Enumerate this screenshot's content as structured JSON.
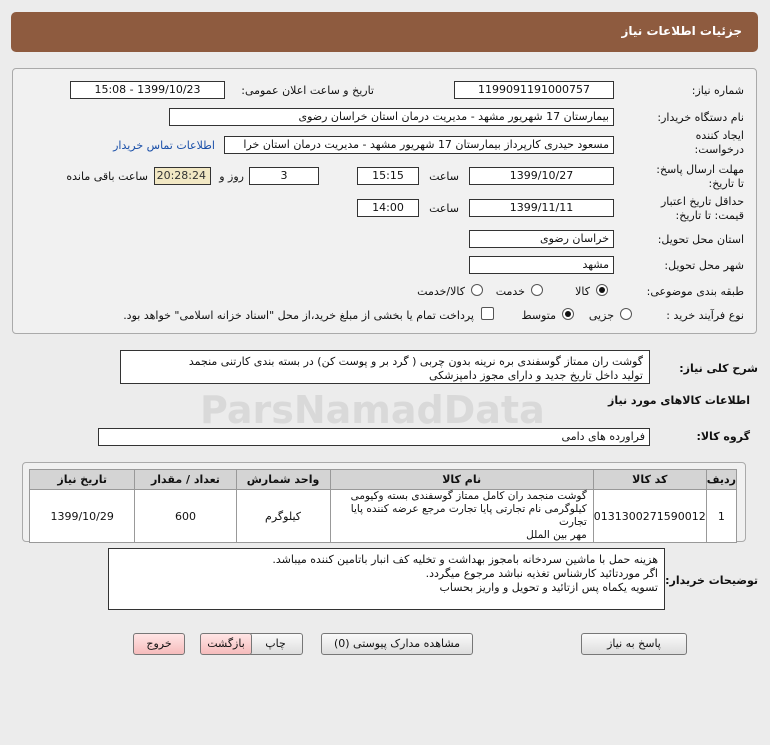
{
  "header": {
    "title": "جزئیات اطلاعات نیاز"
  },
  "form": {
    "need_number_label": "شماره نیاز:",
    "need_number": "1199091191000757",
    "announce_label": "تاریخ و ساعت اعلان عمومی:",
    "announce_value": "1399/10/23 - 15:08",
    "buyer_org_label": "نام دستگاه خریدار:",
    "buyer_org": "بیمارستان 17 شهریور مشهد - مدیریت درمان استان خراسان رضوی",
    "requester_label_1": "ایجاد کننده",
    "requester_label_2": "درخواست:",
    "requester": "مسعود حیدری کارپرداز بیمارستان 17 شهریور مشهد - مدیریت درمان استان خرا",
    "contact_link": "اطلاعات تماس خریدار",
    "send_deadline_label_1": "مهلت ارسال پاسخ:",
    "send_deadline_label_2": "تا تاریخ:",
    "send_date": "1399/10/27",
    "time_label": "ساعت",
    "send_time": "15:15",
    "days_value": "3",
    "days_label": "روز و",
    "remaining_time": "20:28:24",
    "remaining_label": "ساعت باقی مانده",
    "validity_label_1": "حداقل تاریخ اعتبار",
    "validity_label_2": "قیمت: تا تاریخ:",
    "validity_date": "1399/11/11",
    "validity_time_label": "ساعت",
    "validity_time": "14:00",
    "province_label": "استان محل تحویل:",
    "province": "خراسان رضوی",
    "city_label": "شهر محل تحویل:",
    "city": "مشهد",
    "category_label": "طبقه بندی موضوعی:",
    "category_options": [
      "کالا",
      "خدمت",
      "کالا/خدمت"
    ],
    "purchase_type_label": "نوع فرآیند خرید :",
    "purchase_options": [
      "جزیی",
      "متوسط"
    ],
    "payment_note": "پرداخت تمام یا بخشی از مبلغ خرید،از محل \"اسناد خزانه اسلامی\" خواهد بود."
  },
  "summary": {
    "label": "شرح کلی نیاز:",
    "line1": "گوشت ران ممتاز گوسفندی بره نرینه بدون چربی ( گرد بر و پوست کن) در بسته بندی کارتنی منجمد",
    "line2": "تولید داخل تاریخ جدید و دارای مجوز دامپزشکی"
  },
  "goods": {
    "section_title": "اطلاعات کالاهای مورد نیاز",
    "group_label": "گروه کالا:",
    "group_value": "فراورده های دامی",
    "columns": [
      "ردیف",
      "کد کالا",
      "نام کالا",
      "واحد شمارش",
      "تعداد / مقدار",
      "تاریخ نیاز"
    ],
    "rows": [
      {
        "index": "1",
        "code": "0131300271590012",
        "name_line1": "گوشت منجمد ران کامل ممتاز گوسفندی بسته وکیومی",
        "name_line2": "کیلوگرمی نام تجارتی پایا تجارت مرجع عرضه کننده پایا تجارت",
        "name_line3": "مهر بین الملل",
        "unit": "کیلوگرم",
        "qty": "600",
        "date": "1399/10/29"
      }
    ]
  },
  "buyer_notes": {
    "label": "توضیحات خریدار:",
    "line1": "هزینه حمل با ماشین سردخانه بامجوز بهداشت و تخلیه کف انبار باتامین کننده میباشد.",
    "line2": "اگر موردتائید کارشناس تغذیه نباشد مرجوع میگردد.",
    "line3": "تسویه یکماه پس ازتائید و تحویل و واریز بحساب"
  },
  "buttons": {
    "reply": "پاسخ به نیاز",
    "attachments": "مشاهده مدارک پیوستی (0)",
    "print": "چاپ",
    "back": "بازگشت",
    "exit": "خروج"
  }
}
